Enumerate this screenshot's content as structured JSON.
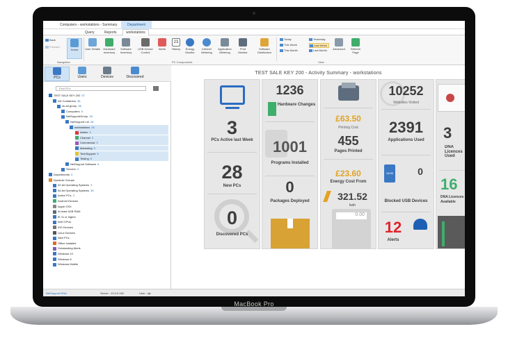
{
  "device": {
    "brand": "MacBook Pro"
  },
  "window": {
    "title": "Computers - workstations - Summary",
    "context_tab": "Department"
  },
  "tabs": [
    "Query",
    "Reports",
    "workstations"
  ],
  "ribbon": {
    "back": "Back",
    "forward": "Forward",
    "home": "Home",
    "buttons": [
      "User Details",
      "Hardware Inventory",
      "Software Inventory",
      "USB Device Control",
      "Alerts",
      "History",
      "Energy Monitor",
      "Internet Metering",
      "Application Metering",
      "Print Monitor",
      "Software Distribution"
    ],
    "history_day": "23",
    "view_left": [
      "Today",
      "This Week",
      "This Month"
    ],
    "view_right": [
      "Yesterday",
      "Last Week",
      "Last Month"
    ],
    "advanced": "Advanced",
    "refresh": "Refresh Page",
    "groups": [
      "Navigation",
      "PC Components",
      "View"
    ]
  },
  "nav_tabs": [
    "PCs",
    "Users",
    "Devices",
    "Discovered"
  ],
  "search": {
    "placeholder": "Find PCs"
  },
  "tree": [
    {
      "label": "TEST SALE KEY 200",
      "count": "37"
    },
    {
      "label": "AD Containers",
      "count": "36"
    },
    {
      "label": "uk.ad-group",
      "count": "36"
    },
    {
      "label": "Computers",
      "count": "5"
    },
    {
      "label": "NetSupportGroup",
      "count": "28"
    },
    {
      "label": "NetSupport Ltd",
      "count": "28"
    },
    {
      "label": "workstations",
      "count": "26"
    },
    {
      "label": "Admin",
      "count": "3"
    },
    {
      "label": "Channel",
      "count": "3"
    },
    {
      "label": "Commercial",
      "count": "3"
    },
    {
      "label": "Marketing",
      "count": "5"
    },
    {
      "label": "TechSupport",
      "count": "5"
    },
    {
      "label": "Testing",
      "count": "8"
    },
    {
      "label": "NetSupport Software",
      "count": "6"
    },
    {
      "label": "Servers",
      "count": "3"
    },
    {
      "label": "Departments",
      "count": "3"
    },
    {
      "label": "Dynamic Groups",
      "count": ""
    },
    {
      "label": "32-bit Operating Systems",
      "count": "2"
    },
    {
      "label": "64-bit Operating Systems",
      "count": "35"
    },
    {
      "label": "Active PCs",
      "count": "3"
    },
    {
      "label": "Android Devices",
      "count": ""
    },
    {
      "label": "Apple OSX",
      "count": ""
    },
    {
      "label": "At least 4GB RAM",
      "count": ""
    },
    {
      "label": "IE 11 or higher",
      "count": ""
    },
    {
      "label": "Intel CPUs",
      "count": ""
    },
    {
      "label": "iOS Devices",
      "count": ""
    },
    {
      "label": "Linux Devices",
      "count": ""
    },
    {
      "label": "New PCs",
      "count": ""
    },
    {
      "label": "Office Installed",
      "count": ""
    },
    {
      "label": "Outstanding Alerts",
      "count": ""
    },
    {
      "label": "Windows 10",
      "count": ""
    },
    {
      "label": "Windows 8",
      "count": ""
    },
    {
      "label": "Windows Mobile",
      "count": ""
    }
  ],
  "status": {
    "left": "NetSupport DNA",
    "server": "Server : 10.0.0.162",
    "user": "User : sjk"
  },
  "summary": {
    "title": "TEST SALE KEY 200 - Activity Summary - workstations",
    "pcs_active": {
      "value": "3",
      "label": "PCs Active last Week"
    },
    "new_pcs": {
      "value": "28",
      "label": "New PCs"
    },
    "discovered": {
      "value": "0",
      "label": "Discovered PCs"
    },
    "hardware_changes": {
      "value": "1236",
      "label": "Hardware Changes"
    },
    "programs_installed": {
      "value": "1001",
      "label": "Programs Installed"
    },
    "packages_deployed": {
      "value": "0",
      "label": "Packages Deployed"
    },
    "printing_cost": {
      "value": "£63.50",
      "label": "Printing Cost"
    },
    "pages_printed": {
      "value": "455",
      "label": "Pages Printed"
    },
    "energy_cost": {
      "value": "£23.60",
      "label": "Energy Cost From"
    },
    "kwh": {
      "value": "321.52",
      "label": "kwh"
    },
    "calc_display": "0.00",
    "websites": {
      "value": "10252",
      "label": "Websites Visited"
    },
    "apps_used": {
      "value": "2391",
      "label": "Applications Used"
    },
    "usb_blocked": {
      "value": "0",
      "label": "Blocked USB Devices",
      "icon_text": "16GB"
    },
    "alerts": {
      "value": "12",
      "label": "Alerts"
    },
    "dna_licence": {
      "value": "3",
      "label": "DNA Licences Used"
    },
    "dna_available": {
      "value": "16",
      "label": "DNA Licences Available"
    }
  },
  "colors": {
    "accent": "#1e6fc4",
    "gold": "#e2a322",
    "alert": "#e2232a",
    "tile": "#e7e7e7"
  }
}
